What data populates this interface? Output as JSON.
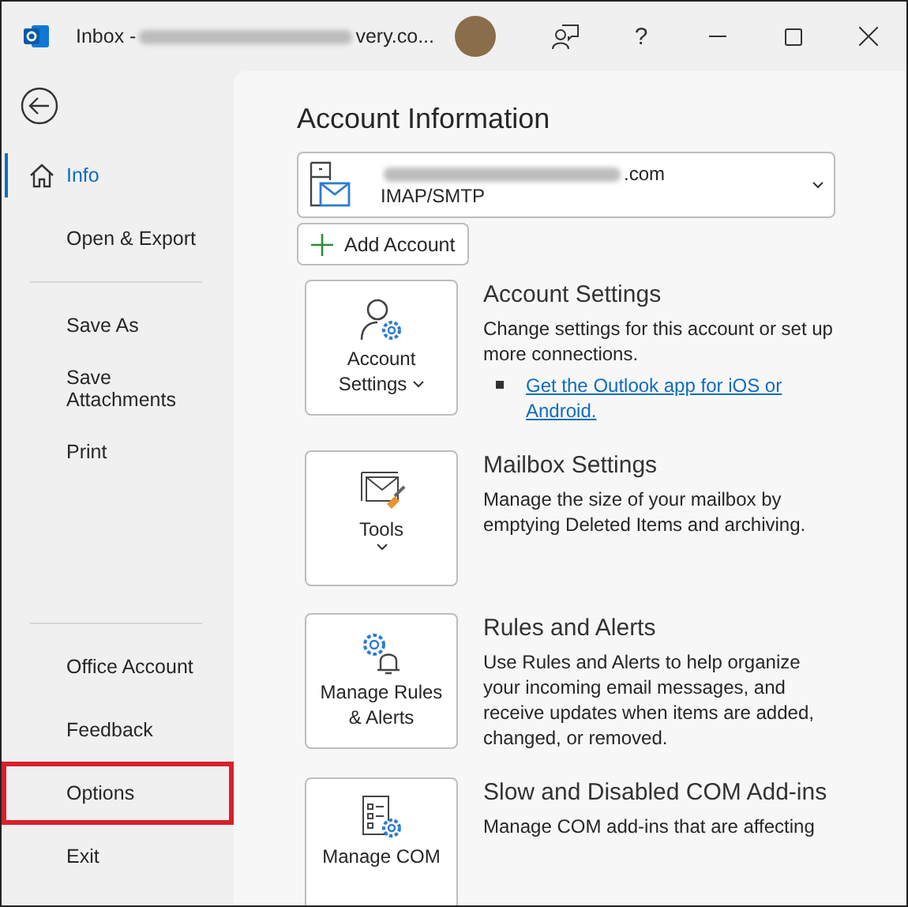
{
  "window": {
    "title_prefix": "Inbox -",
    "title_suffix": "very.co..."
  },
  "title_bar": {
    "help": "?"
  },
  "sidebar": {
    "groups": [
      {
        "items": [
          {
            "label": "Info",
            "selected": true,
            "kind": "home",
            "highlighted": false
          },
          {
            "label": "Open & Export",
            "selected": false,
            "kind": "plain",
            "highlighted": false
          }
        ]
      },
      {
        "items": [
          {
            "label": "Save As",
            "selected": false,
            "kind": "plain",
            "highlighted": false
          },
          {
            "label": "Save Attachments",
            "selected": false,
            "kind": "plain",
            "highlighted": false
          },
          {
            "label": "Print",
            "selected": false,
            "kind": "plain",
            "highlighted": false
          }
        ]
      },
      {
        "items": [
          {
            "label": "Office Account",
            "selected": false,
            "kind": "plain",
            "highlighted": false
          },
          {
            "label": "Feedback",
            "selected": false,
            "kind": "plain",
            "highlighted": false
          },
          {
            "label": "Options",
            "selected": false,
            "kind": "plain",
            "highlighted": true
          },
          {
            "label": "Exit",
            "selected": false,
            "kind": "plain",
            "highlighted": false
          }
        ]
      }
    ]
  },
  "main": {
    "heading": "Account Information",
    "account": {
      "email_suffix": ".com",
      "type": "IMAP/SMTP"
    },
    "add_account": "Add Account",
    "sections": [
      {
        "button_lines": [
          "Account",
          "Settings"
        ],
        "button_caret": true,
        "title": "Account Settings",
        "description": "Change settings for this account or set up more connections.",
        "link": "Get the Outlook app for iOS or Android."
      },
      {
        "button_lines": [
          "Tools"
        ],
        "button_caret": true,
        "title": "Mailbox Settings",
        "description": "Manage the size of your mailbox by emptying Deleted Items and archiving."
      },
      {
        "button_lines": [
          "Manage Rules",
          "& Alerts"
        ],
        "button_caret": false,
        "title": "Rules and Alerts",
        "description": "Use Rules and Alerts to help organize your incoming email messages, and receive updates when items are added, changed, or removed."
      },
      {
        "button_lines": [
          "Manage COM"
        ],
        "button_caret": false,
        "title": "Slow and Disabled COM Add-ins",
        "description": "Manage COM add-ins that are affecting"
      }
    ]
  }
}
